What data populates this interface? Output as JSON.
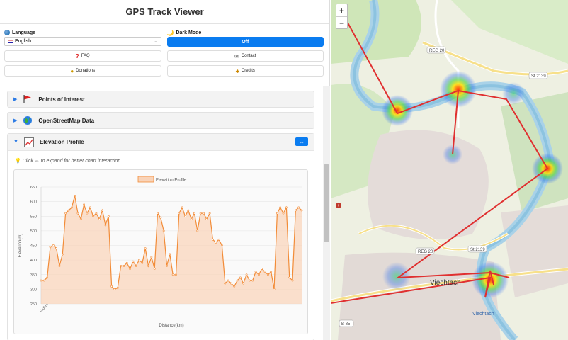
{
  "app": {
    "title": "GPS Track Viewer"
  },
  "controls": {
    "language_label": "Language",
    "language_value": "English",
    "darkmode_label": "Dark Mode",
    "darkmode_value": "Off",
    "buttons": [
      {
        "label": "FAQ",
        "icon": "question-icon"
      },
      {
        "label": "Contact",
        "icon": "mail-icon"
      },
      {
        "label": "Donations",
        "icon": "money-bag-icon"
      },
      {
        "label": "Credits",
        "icon": "people-icon"
      }
    ]
  },
  "sections": [
    {
      "title": "Points of Interest",
      "icon": "flag-icon"
    },
    {
      "title": "OpenStreetMap Data",
      "icon": "globe-icon"
    },
    {
      "title": "Elevation Profile",
      "icon": "chart-icon"
    }
  ],
  "elevation": {
    "expand_label": "⇔",
    "hint": "Click ⇔ to expand for better chart interaction"
  },
  "map": {
    "zoom_in": "+",
    "zoom_out": "−",
    "labels": [
      "REG 20",
      "St 2139",
      "Viechtach",
      "REG 20",
      "St 2139",
      "Viechtach",
      "B 85"
    ]
  },
  "chart_data": {
    "type": "area",
    "legend": "Elevation Profile",
    "xlabel": "Distance(km)",
    "ylabel": "Elevation(m)",
    "x_tick": "0.0km",
    "ylim": [
      250,
      650
    ],
    "yticks": [
      250,
      300,
      350,
      400,
      450,
      500,
      550,
      600,
      650
    ],
    "values": [
      330,
      330,
      340,
      445,
      450,
      440,
      380,
      420,
      560,
      570,
      580,
      620,
      560,
      540,
      590,
      560,
      580,
      550,
      560,
      540,
      570,
      520,
      550,
      310,
      300,
      305,
      380,
      380,
      390,
      370,
      395,
      380,
      400,
      390,
      440,
      380,
      410,
      370,
      560,
      545,
      500,
      380,
      420,
      350,
      350,
      560,
      580,
      550,
      570,
      540,
      560,
      500,
      560,
      560,
      540,
      560,
      470,
      460,
      470,
      450,
      320,
      330,
      320,
      310,
      330,
      340,
      320,
      350,
      330,
      330,
      360,
      350,
      370,
      360,
      350,
      360,
      300,
      560,
      580,
      560,
      580,
      340,
      330,
      570,
      580,
      570
    ]
  },
  "colors": {
    "accent": "#0a7cf0",
    "series": "#f28c38",
    "area": "#f9d3b8",
    "track": "#e03030"
  }
}
